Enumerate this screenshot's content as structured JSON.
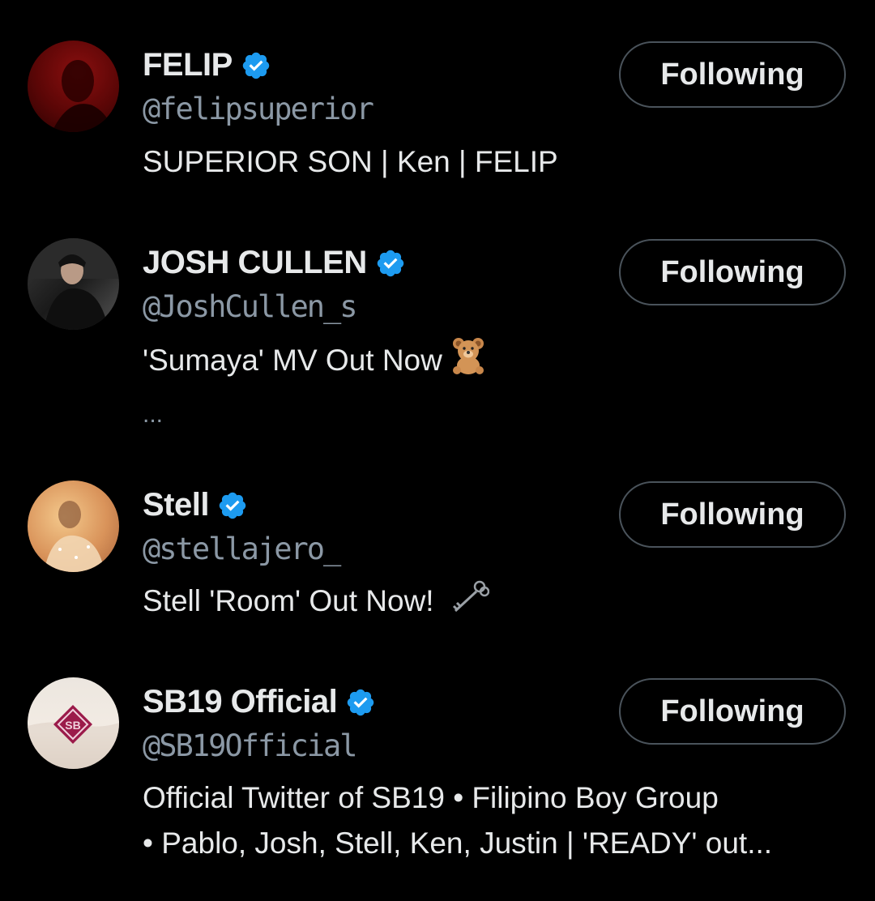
{
  "accent": "#1d9bf0",
  "users": [
    {
      "name": "FELIP",
      "handle": "@felipsuperior",
      "bio_lines": [
        "SUPERIOR SON | Ken | FELIP"
      ],
      "verified": true,
      "button_label": "Following"
    },
    {
      "name": "JOSH CULLEN",
      "handle": "@JoshCullen_s",
      "bio_lines": [
        "'Sumaya' MV Out Now",
        "..."
      ],
      "bio_emoji": "teddy-bear-icon",
      "verified": true,
      "button_label": "Following"
    },
    {
      "name": "Stell",
      "handle": "@stellajero_",
      "bio_lines": [
        "Stell 'Room' Out Now!"
      ],
      "bio_emoji": "old-key-icon",
      "verified": true,
      "button_label": "Following"
    },
    {
      "name": "SB19 Official",
      "handle": "@SB19Official",
      "bio_lines": [
        "Official Twitter of SB19 • Filipino Boy Group",
        "• Pablo, Josh, Stell, Ken, Justin | 'READY' out..."
      ],
      "verified": true,
      "button_label": "Following"
    }
  ]
}
